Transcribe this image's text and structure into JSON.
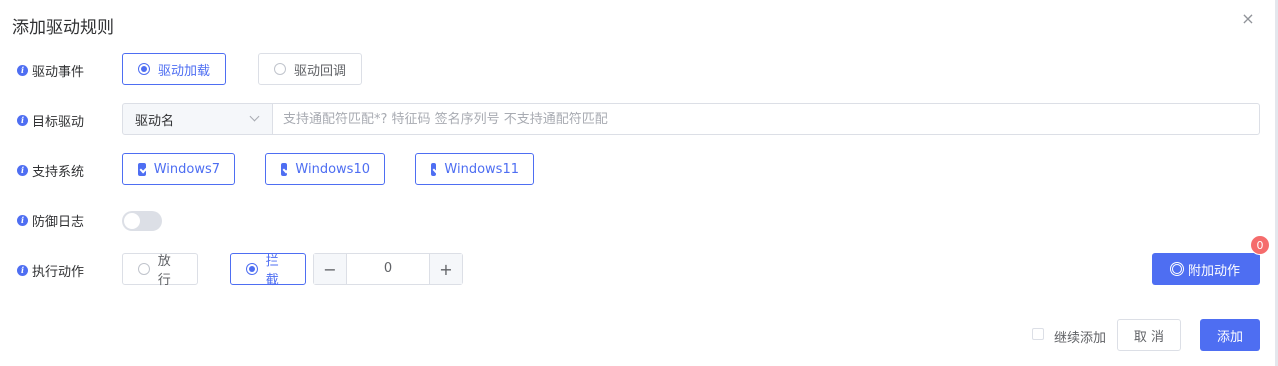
{
  "dialog": {
    "title": "添加驱动规则",
    "close_icon": "×"
  },
  "info_icon_glyph": "i",
  "rows": {
    "event": {
      "label": "驱动事件",
      "options": [
        {
          "label": "驱动加载",
          "selected": true
        },
        {
          "label": "驱动回调",
          "selected": false
        }
      ]
    },
    "target": {
      "label": "目标驱动",
      "select_value": "驱动名",
      "input_value": "",
      "input_placeholder": "支持通配符匹配*? 特征码 签名序列号 不支持通配符匹配"
    },
    "systems": {
      "label": "支持系统",
      "options": [
        {
          "label": "Windows7",
          "checked": true
        },
        {
          "label": "Windows10",
          "checked": true
        },
        {
          "label": "Windows11",
          "checked": true
        }
      ]
    },
    "defense_log": {
      "label": "防御日志",
      "enabled": false
    },
    "action": {
      "label": "执行动作",
      "options": [
        {
          "label": "放行",
          "selected": false
        },
        {
          "label": "拦截",
          "selected": true
        }
      ],
      "stepper": {
        "minus": "−",
        "value": "0",
        "plus": "+"
      },
      "extra_button": {
        "label": "附加动作",
        "badge": "0"
      }
    }
  },
  "footer": {
    "continue_add_label": "继续添加",
    "continue_add_checked": false,
    "cancel_label": "取 消",
    "add_label": "添加"
  },
  "colors": {
    "primary": "#4e6ef2",
    "badge": "#f56c6c",
    "border": "#dcdfe6"
  }
}
